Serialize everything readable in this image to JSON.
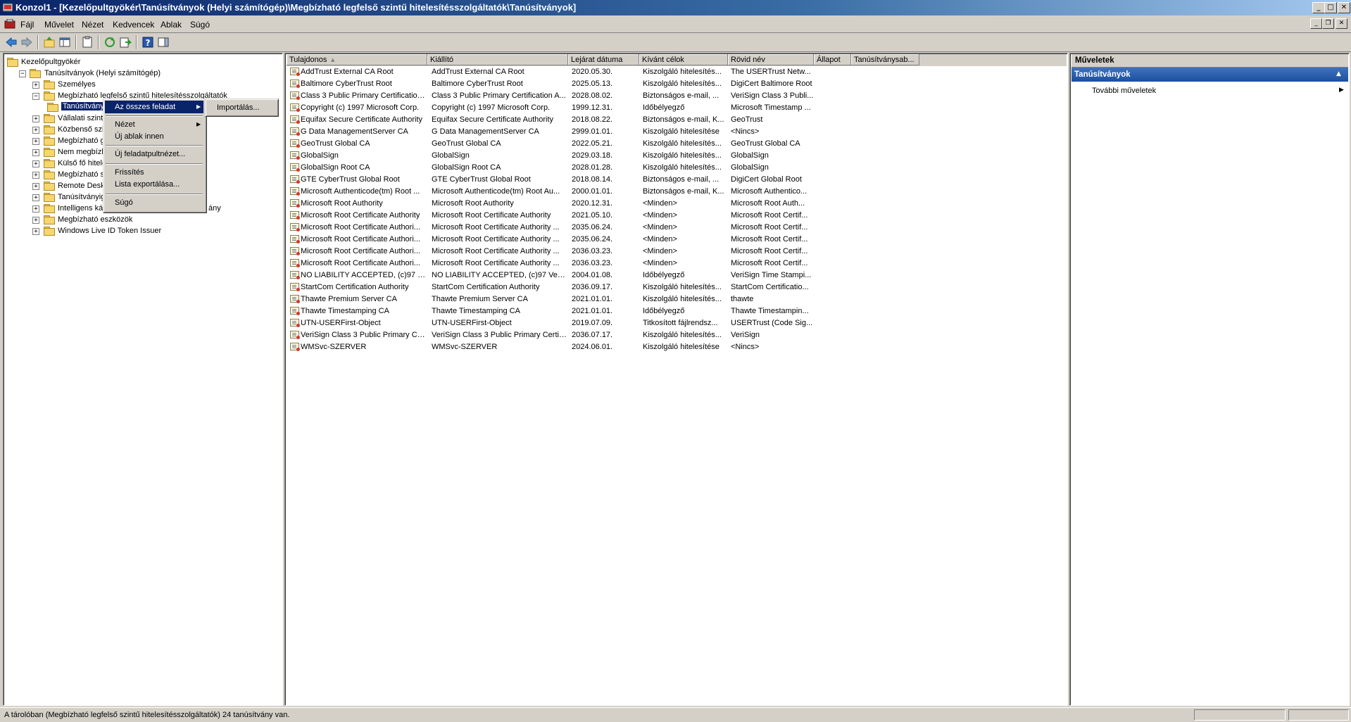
{
  "window": {
    "title": "Konzol1 - [Kezelőpultgyökér\\Tanúsítványok (Helyi számítógép)\\Megbízható legfelső szintű hitelesítésszolgáltatók\\Tanúsítványok]",
    "title_buttons": [
      "_",
      "□",
      "✕"
    ],
    "mdi_buttons": [
      "_",
      "❐",
      "✕"
    ]
  },
  "menubar": [
    "Fájl",
    "Művelet",
    "Nézet",
    "Kedvencek",
    "Ablak",
    "Súgó"
  ],
  "toolbar": {
    "icons": [
      "back-icon",
      "forward-icon",
      "up-icon",
      "show-hide-tree-icon",
      "properties-icon",
      "refresh-icon",
      "export-list-icon",
      "help-icon",
      "show-hide-action-pane-icon"
    ]
  },
  "tree": {
    "items": [
      {
        "label": "Kezelőpultgyökér",
        "expander": ""
      },
      {
        "label": "Tanúsítványok (Helyi számítógép)",
        "expander": "−"
      },
      {
        "label": "Személyes",
        "expander": "+"
      },
      {
        "label": "Megbízható legfelső szintű hitelesítésszolgáltatók",
        "expander": "−"
      },
      {
        "label": "Tanúsítvány",
        "expander": ""
      },
      {
        "label": "Vállalati szintű m",
        "expander": "+"
      },
      {
        "label": "Közbenső szintű",
        "expander": "+"
      },
      {
        "label": "Megbízható gyár",
        "expander": "+"
      },
      {
        "label": "Nem megbízható",
        "expander": "+"
      },
      {
        "label": "Külső fő hitelesít",
        "expander": "+"
      },
      {
        "label": "Megbízható szem",
        "expander": "+"
      },
      {
        "label": "Remote Desktop",
        "expander": "+"
      },
      {
        "label": "Tanúsítványigén",
        "expander": "+"
      },
      {
        "label": "Intelligens kárty",
        "expander": "+",
        "tail": "ány"
      },
      {
        "label": "Megbízható eszközök",
        "expander": "+"
      },
      {
        "label": "Windows Live ID Token Issuer",
        "expander": "+"
      }
    ]
  },
  "context_menu": {
    "items": [
      {
        "label": "Az összes feladat",
        "submenu": true,
        "highlighted": true
      },
      {
        "label": "Nézet",
        "submenu": true
      },
      {
        "label": "Új ablak innen"
      },
      {
        "label": "Új feladatpultnézet..."
      },
      {
        "label": "Frissítés"
      },
      {
        "label": "Lista exportálása..."
      },
      {
        "label": "Súgó"
      }
    ],
    "submenu": {
      "items": [
        "Importálás..."
      ]
    }
  },
  "list": {
    "columns": [
      "Tulajdonos",
      "Kiállító",
      "Lejárat dátuma",
      "Kívánt célok",
      "Rövid név",
      "Állapot",
      "Tanúsítványsab..."
    ],
    "sort_indicator": "▲",
    "rows": [
      [
        "AddTrust External CA Root",
        "AddTrust External CA Root",
        "2020.05.30.",
        "Kiszolgáló hitelesítés...",
        "The USERTrust Netw..."
      ],
      [
        "Baltimore CyberTrust Root",
        "Baltimore CyberTrust Root",
        "2025.05.13.",
        "Kiszolgáló hitelesítés...",
        "DigiCert Baltimore Root"
      ],
      [
        "Class 3 Public Primary Certification...",
        "Class 3 Public Primary Certification A...",
        "2028.08.02.",
        "Biztonságos e-mail, ...",
        "VeriSign Class 3 Publi..."
      ],
      [
        "Copyright (c) 1997 Microsoft Corp.",
        "Copyright (c) 1997 Microsoft Corp.",
        "1999.12.31.",
        "Időbélyegző",
        "Microsoft Timestamp ..."
      ],
      [
        "Equifax Secure Certificate Authority",
        "Equifax Secure Certificate Authority",
        "2018.08.22.",
        "Biztonságos e-mail, K...",
        "GeoTrust"
      ],
      [
        "G Data ManagementServer CA",
        "G Data ManagementServer CA",
        "2999.01.01.",
        "Kiszolgáló hitelesítése",
        "<Nincs>"
      ],
      [
        "GeoTrust Global CA",
        "GeoTrust Global CA",
        "2022.05.21.",
        "Kiszolgáló hitelesítés...",
        "GeoTrust Global CA"
      ],
      [
        "GlobalSign",
        "GlobalSign",
        "2029.03.18.",
        "Kiszolgáló hitelesítés...",
        "GlobalSign"
      ],
      [
        "GlobalSign Root CA",
        "GlobalSign Root CA",
        "2028.01.28.",
        "Kiszolgáló hitelesítés...",
        "GlobalSign"
      ],
      [
        "GTE CyberTrust Global Root",
        "GTE CyberTrust Global Root",
        "2018.08.14.",
        "Biztonságos e-mail, ...",
        "DigiCert Global Root"
      ],
      [
        "Microsoft Authenticode(tm) Root ...",
        "Microsoft Authenticode(tm) Root Au...",
        "2000.01.01.",
        "Biztonságos e-mail, K...",
        "Microsoft Authentico..."
      ],
      [
        "Microsoft Root Authority",
        "Microsoft Root Authority",
        "2020.12.31.",
        "<Minden>",
        "Microsoft Root Auth..."
      ],
      [
        "Microsoft Root Certificate Authority",
        "Microsoft Root Certificate Authority",
        "2021.05.10.",
        "<Minden>",
        "Microsoft Root Certif..."
      ],
      [
        "Microsoft Root Certificate Authori...",
        "Microsoft Root Certificate Authority ...",
        "2035.06.24.",
        "<Minden>",
        "Microsoft Root Certif..."
      ],
      [
        "Microsoft Root Certificate Authori...",
        "Microsoft Root Certificate Authority ...",
        "2035.06.24.",
        "<Minden>",
        "Microsoft Root Certif..."
      ],
      [
        "Microsoft Root Certificate Authori...",
        "Microsoft Root Certificate Authority ...",
        "2036.03.23.",
        "<Minden>",
        "Microsoft Root Certif..."
      ],
      [
        "Microsoft Root Certificate Authori...",
        "Microsoft Root Certificate Authority ...",
        "2036.03.23.",
        "<Minden>",
        "Microsoft Root Certif..."
      ],
      [
        "NO LIABILITY ACCEPTED, (c)97 V...",
        "NO LIABILITY ACCEPTED, (c)97 Veri...",
        "2004.01.08.",
        "Időbélyegző",
        "VeriSign Time Stampi..."
      ],
      [
        "StartCom Certification Authority",
        "StartCom Certification Authority",
        "2036.09.17.",
        "Kiszolgáló hitelesítés...",
        "StartCom Certificatio..."
      ],
      [
        "Thawte Premium Server CA",
        "Thawte Premium Server CA",
        "2021.01.01.",
        "Kiszolgáló hitelesítés...",
        "thawte"
      ],
      [
        "Thawte Timestamping CA",
        "Thawte Timestamping CA",
        "2021.01.01.",
        "Időbélyegző",
        "Thawte Timestampin..."
      ],
      [
        "UTN-USERFirst-Object",
        "UTN-USERFirst-Object",
        "2019.07.09.",
        "Titkosított fájlrendsz...",
        "USERTrust (Code Sig..."
      ],
      [
        "VeriSign Class 3 Public Primary Cer...",
        "VeriSign Class 3 Public Primary Certifi...",
        "2036.07.17.",
        "Kiszolgáló hitelesítés...",
        "VeriSign"
      ],
      [
        "WMSvc-SZERVER",
        "WMSvc-SZERVER",
        "2024.06.01.",
        "Kiszolgáló hitelesítése",
        "<Nincs>"
      ]
    ]
  },
  "actions": {
    "title": "Műveletek",
    "section": "Tanúsítványok",
    "section_caret": "▲",
    "items": [
      {
        "label": "További műveletek",
        "arrow": "▶"
      }
    ]
  },
  "statusbar": {
    "text": "A tárolóban (Megbízható legfelső szintű hitelesítésszolgáltatók) 24 tanúsítvány van."
  },
  "colors": {
    "highlight": "#0a246a",
    "action_header": "#1c4f9c",
    "face": "#d4d0c8"
  }
}
